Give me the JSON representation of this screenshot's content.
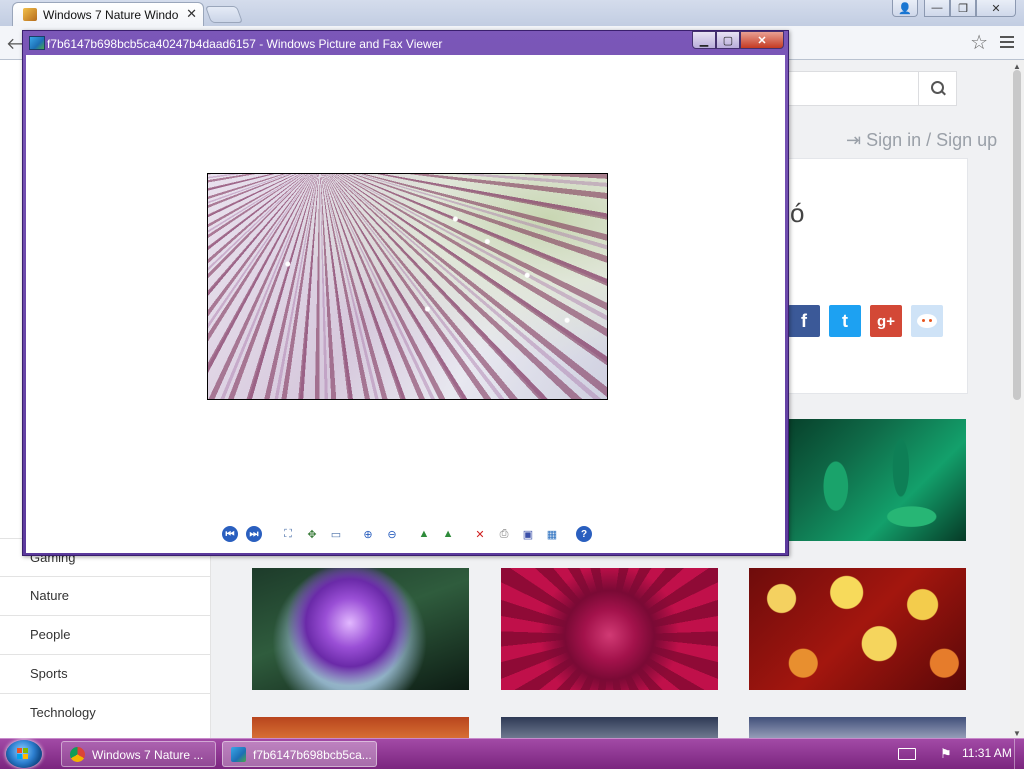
{
  "browser": {
    "tab_title": "Windows 7 Nature Windo",
    "tab_close": "✕",
    "controls": {
      "user": "👤",
      "min": "—",
      "max": "❐",
      "close": "✕"
    }
  },
  "page": {
    "sign_in": "Sign in / Sign up",
    "card_title_fragment": "ó",
    "social": {
      "facebook": "f",
      "twitter": "t",
      "googleplus": "g+",
      "reddit": ""
    },
    "sidebar_items": [
      "Gaming",
      "Nature",
      "People",
      "Sports",
      "Technology"
    ]
  },
  "viewer": {
    "title": "f7b6147b698bcb5ca40247b4daad6157 - Windows Picture and Fax Viewer",
    "tools": [
      {
        "name": "previous-image-icon",
        "glyph": "⏮",
        "color": "#1f5fc8"
      },
      {
        "name": "next-image-icon",
        "glyph": "⏭",
        "color": "#1f5fc8"
      },
      {
        "name": "best-fit-icon",
        "glyph": "⛶",
        "color": "#4a6fa8"
      },
      {
        "name": "actual-size-icon",
        "glyph": "✥",
        "color": "#3c7d3c"
      },
      {
        "name": "slideshow-icon",
        "glyph": "▭",
        "color": "#4a6fa8"
      },
      {
        "name": "zoom-in-icon",
        "glyph": "⊕",
        "color": "#2a5fbf"
      },
      {
        "name": "zoom-out-icon",
        "glyph": "⊖",
        "color": "#2a5fbf"
      },
      {
        "name": "rotate-clockwise-icon",
        "glyph": "▲",
        "color": "#2e8b3a"
      },
      {
        "name": "rotate-counterclockwise-icon",
        "glyph": "▲",
        "color": "#2e8b3a"
      },
      {
        "name": "delete-icon",
        "glyph": "✕",
        "color": "#d02020"
      },
      {
        "name": "print-icon",
        "glyph": "⎙",
        "color": "#777777"
      },
      {
        "name": "save-icon",
        "glyph": "▣",
        "color": "#3a4fa8"
      },
      {
        "name": "open-for-editing-icon",
        "glyph": "▦",
        "color": "#2a6fbf"
      },
      {
        "name": "help-icon",
        "glyph": "?",
        "color": "#2a5fbf"
      }
    ]
  },
  "taskbar": {
    "tasks": [
      "Windows 7 Nature ...",
      "f7b6147b698bcb5ca..."
    ],
    "clock": "11:31 AM"
  }
}
